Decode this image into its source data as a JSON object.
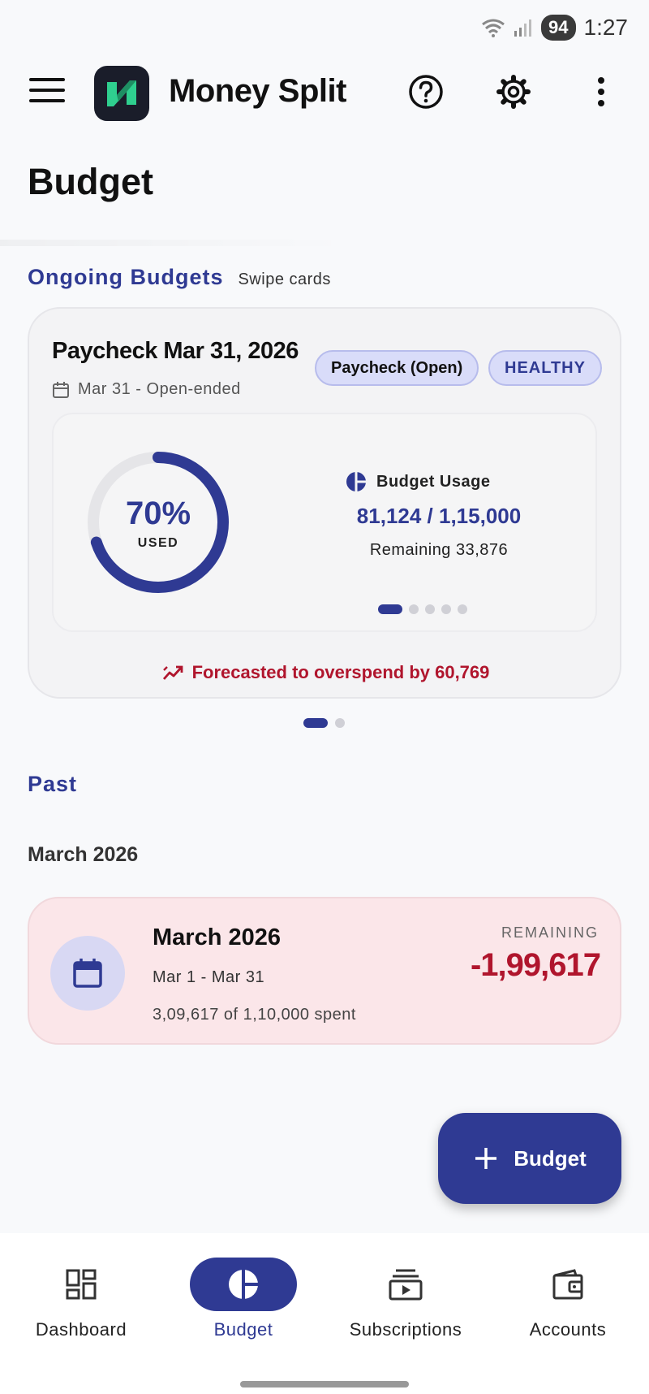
{
  "status_bar": {
    "battery": "94",
    "time": "1:27"
  },
  "app_bar": {
    "title": "Money Split"
  },
  "page": {
    "title": "Budget"
  },
  "ongoing": {
    "title": "Ongoing Budgets",
    "hint": "Swipe cards",
    "card": {
      "name": "Paycheck Mar 31, 2026",
      "dates": "Mar 31 - Open-ended",
      "type_chip": "Paycheck (Open)",
      "status_chip": "HEALTHY",
      "used_percent": "70%",
      "used_fraction": 0.7,
      "used_label": "USED",
      "usage_title": "Budget Usage",
      "usage_amount": "81,124 / 1,15,000",
      "remaining": "Remaining 33,876",
      "forecast": "Forecasted to overspend by 60,769",
      "inner_page_count": 5,
      "inner_page_active": 0
    },
    "card_count": 2,
    "card_active": 0
  },
  "past": {
    "title": "Past",
    "month_label": "March 2026",
    "card": {
      "name": "March 2026",
      "range": "Mar 1 - Mar 31",
      "spent": "3,09,617 of 1,10,000 spent",
      "remaining_label": "REMAINING",
      "remaining_value": "-1,99,617"
    }
  },
  "fab": {
    "label": "Budget"
  },
  "nav": {
    "items": [
      {
        "label": "Dashboard",
        "icon": "dashboard-icon"
      },
      {
        "label": "Budget",
        "icon": "pie-chart-icon"
      },
      {
        "label": "Subscriptions",
        "icon": "subscriptions-icon"
      },
      {
        "label": "Accounts",
        "icon": "wallet-icon"
      }
    ],
    "active": 1
  },
  "colors": {
    "primary": "#2f3a93",
    "danger": "#b0152d",
    "chip_bg": "#d9dcf9",
    "past_card_bg": "#fbe6e9"
  }
}
